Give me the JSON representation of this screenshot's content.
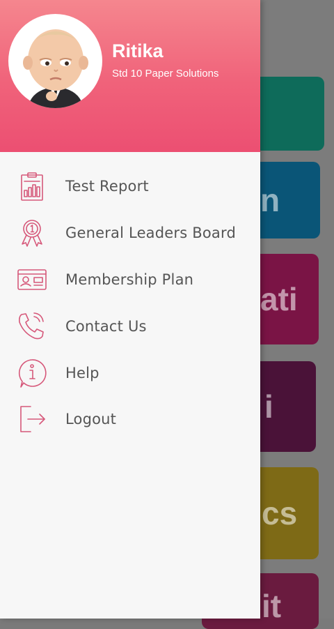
{
  "header": {
    "user_name": "Ritika",
    "user_subtitle": "Std 10 Paper Solutions"
  },
  "menu": {
    "items": [
      {
        "label": "Test Report",
        "icon": "report-clipboard-icon"
      },
      {
        "label": "General Leaders Board",
        "icon": "medal-icon"
      },
      {
        "label": "Membership Plan",
        "icon": "id-card-icon"
      },
      {
        "label": "Contact Us",
        "icon": "phone-icon"
      },
      {
        "label": "Help",
        "icon": "info-icon"
      },
      {
        "label": "Logout",
        "icon": "logout-icon"
      }
    ]
  },
  "background": {
    "cards": [
      {
        "color": "#0f8a72",
        "text": ""
      },
      {
        "color": "#0a6a99",
        "text": "n"
      },
      {
        "color": "#a01a5a",
        "text": "ati"
      },
      {
        "color": "#5e1648",
        "text": "i"
      },
      {
        "color": "#a58a1c",
        "text": "cs"
      },
      {
        "color": "#8a2352",
        "text": "it"
      }
    ]
  },
  "colors": {
    "accent": "#ec4f72",
    "icon": "#d6587a"
  }
}
